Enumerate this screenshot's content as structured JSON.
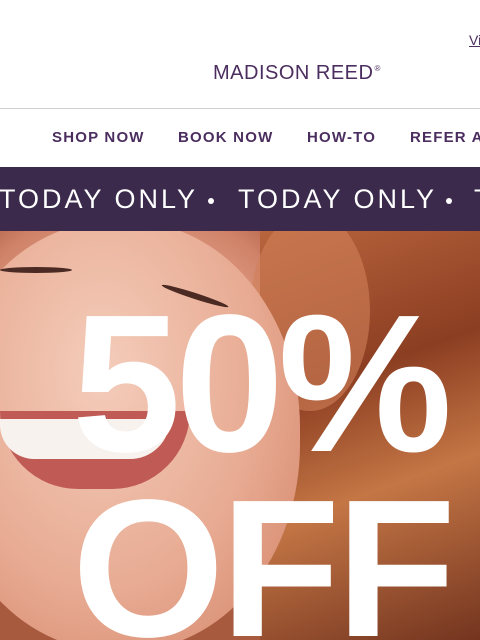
{
  "header": {
    "view_link": "Vi",
    "logo_text": "MADISON REED",
    "logo_mark": "®"
  },
  "nav": {
    "items": [
      {
        "label": "SHOP NOW"
      },
      {
        "label": "BOOK NOW"
      },
      {
        "label": "HOW-TO"
      },
      {
        "label": "REFER A"
      }
    ]
  },
  "banner": {
    "segments": [
      "TODAY ONLY",
      "TODAY ONLY",
      "T"
    ]
  },
  "hero": {
    "headline_1": "50%",
    "headline_2": "OFF"
  },
  "colors": {
    "brand_purple": "#4b2e5f",
    "banner_bg": "#3b2a4c",
    "divider": "#cfcfcf",
    "promo_text": "#ffffff"
  }
}
